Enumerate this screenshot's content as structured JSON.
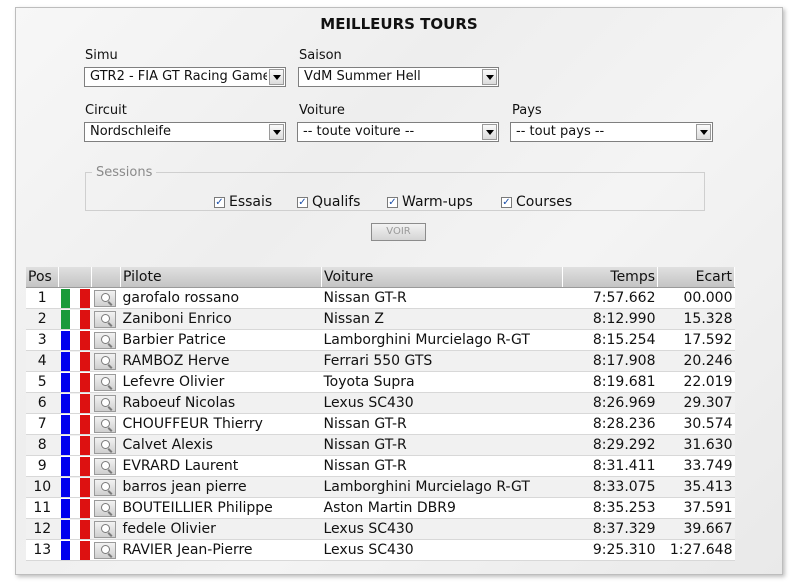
{
  "title": "MEILLEURS TOURS",
  "filters": {
    "simu": {
      "label": "Simu",
      "value": "GTR2 - FIA GT Racing Game"
    },
    "saison": {
      "label": "Saison",
      "value": "VdM Summer Hell"
    },
    "circuit": {
      "label": "Circuit",
      "value": "Nordschleife"
    },
    "voiture": {
      "label": "Voiture",
      "value": "-- toute voiture --"
    },
    "pays": {
      "label": "Pays",
      "value": "-- tout pays --"
    }
  },
  "sessions": {
    "legend": "Sessions",
    "items": [
      {
        "label": "Essais",
        "checked": true
      },
      {
        "label": "Qualifs",
        "checked": true
      },
      {
        "label": "Warm-ups",
        "checked": true
      },
      {
        "label": "Courses",
        "checked": true
      }
    ]
  },
  "button": {
    "label": "VOIR"
  },
  "table": {
    "columns": {
      "pos": "Pos",
      "pilote": "Pilote",
      "voiture": "Voiture",
      "temps": "Temps",
      "ecart": "Ecart"
    },
    "rows": [
      {
        "pos": "1",
        "flag": "italy",
        "pilote": "garofalo rossano",
        "voiture": "Nissan GT-R",
        "temps": "7:57.662",
        "ecart": "00.000"
      },
      {
        "pos": "2",
        "flag": "italy",
        "pilote": "Zaniboni Enrico",
        "voiture": "Nissan Z",
        "temps": "8:12.990",
        "ecart": "15.328"
      },
      {
        "pos": "3",
        "flag": "france",
        "pilote": "Barbier Patrice",
        "voiture": "Lamborghini Murcielago R-GT",
        "temps": "8:15.254",
        "ecart": "17.592"
      },
      {
        "pos": "4",
        "flag": "france",
        "pilote": "RAMBOZ Herve",
        "voiture": "Ferrari 550 GTS",
        "temps": "8:17.908",
        "ecart": "20.246"
      },
      {
        "pos": "5",
        "flag": "france",
        "pilote": "Lefevre Olivier",
        "voiture": "Toyota Supra",
        "temps": "8:19.681",
        "ecart": "22.019"
      },
      {
        "pos": "6",
        "flag": "france",
        "pilote": "Raboeuf Nicolas",
        "voiture": "Lexus SC430",
        "temps": "8:26.969",
        "ecart": "29.307"
      },
      {
        "pos": "7",
        "flag": "france",
        "pilote": "CHOUFFEUR Thierry",
        "voiture": "Nissan GT-R",
        "temps": "8:28.236",
        "ecart": "30.574"
      },
      {
        "pos": "8",
        "flag": "france",
        "pilote": "Calvet Alexis",
        "voiture": "Nissan GT-R",
        "temps": "8:29.292",
        "ecart": "31.630"
      },
      {
        "pos": "9",
        "flag": "france",
        "pilote": "EVRARD Laurent",
        "voiture": "Nissan GT-R",
        "temps": "8:31.411",
        "ecart": "33.749"
      },
      {
        "pos": "10",
        "flag": "france",
        "pilote": "barros jean pierre",
        "voiture": "Lamborghini Murcielago R-GT",
        "temps": "8:33.075",
        "ecart": "35.413"
      },
      {
        "pos": "11",
        "flag": "france",
        "pilote": "BOUTEILLIER Philippe",
        "voiture": "Aston Martin DBR9",
        "temps": "8:35.253",
        "ecart": "37.591"
      },
      {
        "pos": "12",
        "flag": "france",
        "pilote": "fedele Olivier",
        "voiture": "Lexus SC430",
        "temps": "8:37.329",
        "ecart": "39.667"
      },
      {
        "pos": "13",
        "flag": "france",
        "pilote": "RAVIER Jean-Pierre",
        "voiture": "Lexus SC430",
        "temps": "9:25.310",
        "ecart": "1:27.648"
      }
    ]
  },
  "colors": {
    "italy_green": "#1a9a3a",
    "france_blue": "#0000ee",
    "flag_red": "#dd1111",
    "flag_white": "#ffffff"
  }
}
